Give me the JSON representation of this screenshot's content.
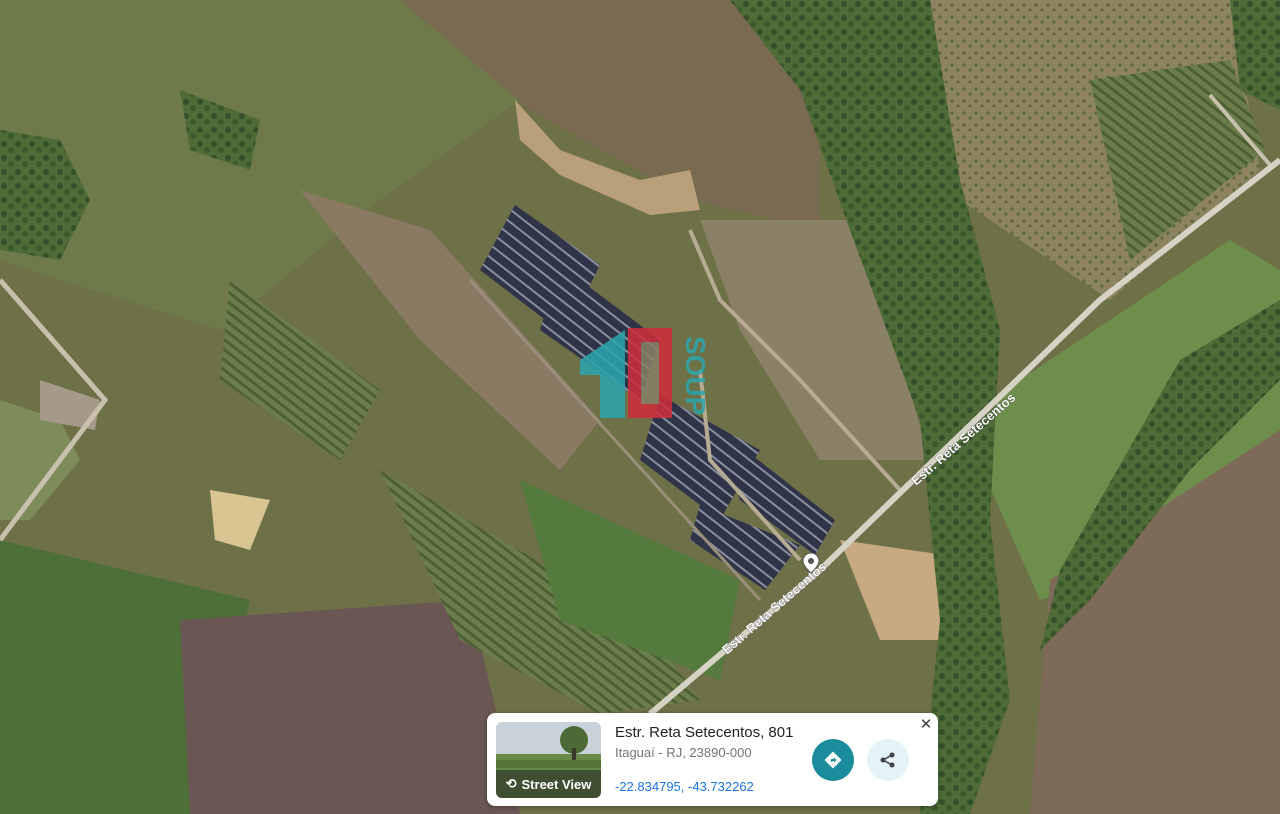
{
  "map": {
    "road_labels": [
      "Estr. Reta Setecentos",
      "Estr. Reta Setecentos"
    ],
    "watermark_text": "SOUP"
  },
  "place_card": {
    "street_view_label": "Street View",
    "title": "Estr. Reta Setecentos, 801",
    "subtitle": "Itaguaí - RJ, 23890-000",
    "coordinates": "-22.834795, -43.732262",
    "directions_icon": "directions-icon",
    "share_icon": "share-icon",
    "close_icon": "close-icon"
  }
}
